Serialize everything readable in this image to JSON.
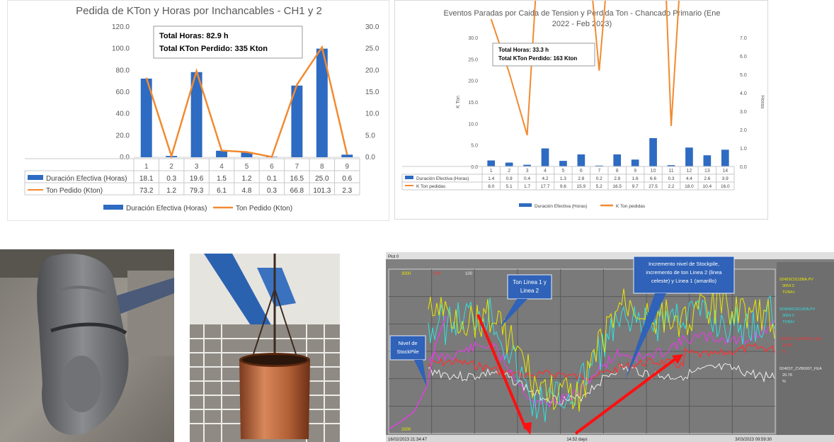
{
  "colors": {
    "bar": "#2e6bc2",
    "line": "#f28a30",
    "axis_text": "#595959"
  },
  "chart_data": [
    {
      "type": "bar",
      "title": "Pedida de KTon y Horas por Inchancables - CH1 y 2",
      "categories": [
        "1",
        "2",
        "3",
        "4",
        "5",
        "6",
        "7",
        "8",
        "9"
      ],
      "series": [
        {
          "name": "Duración Efectiva (Horas)",
          "type": "bar",
          "axis": "right",
          "values": [
            18.1,
            0.3,
            19.6,
            1.5,
            1.2,
            0.1,
            16.5,
            25.0,
            0.6
          ]
        },
        {
          "name": "Ton Pedido (Kton)",
          "type": "line",
          "axis": "left",
          "values": [
            73.2,
            1.2,
            79.3,
            6.1,
            4.8,
            0.3,
            66.8,
            101.3,
            2.3
          ]
        }
      ],
      "left_axis": {
        "ylim": [
          0,
          120
        ],
        "ticks": [
          "0.0",
          "20.0",
          "40.0",
          "60.0",
          "80.0",
          "100.0",
          "120.0"
        ]
      },
      "right_axis": {
        "ylim": [
          0,
          30
        ],
        "ticks": [
          "0.0",
          "5.0",
          "10.0",
          "15.0",
          "20.0",
          "25.0",
          "30.0"
        ]
      },
      "annotation": [
        "Total Horas:  82.9 h",
        "Total KTon Perdido: 335 Kton"
      ],
      "legend_bottom": [
        "Duración Efectiva (Horas)",
        "Ton Pedido (Kton)"
      ],
      "data_table": true
    },
    {
      "type": "bar",
      "title": [
        "Eventos Paradas por Caida de Tension y Perdida Ton - Chancado Primario (Ene",
        "2022 - Feb 2023)"
      ],
      "categories": [
        "1",
        "2",
        "3",
        "4",
        "5",
        "6",
        "7",
        "8",
        "9",
        "10",
        "11",
        "12",
        "13",
        "14"
      ],
      "series": [
        {
          "name": "Duración Efectiva (Horas)",
          "type": "bar",
          "axis": "left",
          "values": [
            1.4,
            0.9,
            0.4,
            4.2,
            1.3,
            2.8,
            0.2,
            2.8,
            1.6,
            6.6,
            0.3,
            4.4,
            2.6,
            3.9
          ]
        },
        {
          "name": "K Ton pedidas",
          "type": "line",
          "axis": "right",
          "values": [
            8.0,
            5.1,
            1.7,
            17.7,
            9.6,
            15.9,
            5.2,
            16.5,
            9.7,
            27.5,
            2.2,
            18.0,
            10.4,
            16.0
          ]
        }
      ],
      "left_axis": {
        "label": "K Ton",
        "ylim": [
          0,
          30
        ],
        "ticks": [
          "0.0",
          "5.0",
          "10.0",
          "15.0",
          "20.0",
          "25.0",
          "30.0"
        ]
      },
      "right_axis": {
        "label": "Horas",
        "ylim": [
          0,
          7
        ],
        "ticks": [
          "0.0",
          "1.0",
          "2.0",
          "3.0",
          "4.0",
          "5.0",
          "6.0",
          "7.0"
        ]
      },
      "annotation": [
        "Total Horas:  33.3 h",
        "Total KTon Perdido: 163 Kton"
      ],
      "legend_bottom": [
        "Duración Efectiva (Horas)",
        "K Ton pedidas"
      ],
      "data_table": true
    }
  ],
  "photos": {
    "left": "worn-crusher-liner-photo",
    "middle": "copper-bushing-hoisted-photo"
  },
  "trend": {
    "plot_label": "Plot 0",
    "top_scale_values": [
      "3000",
      "100",
      "100"
    ],
    "bottom_scale_value": "2000",
    "start_time": "16/02/2023 21:34:47",
    "end_time": "3/03/2023 09:59:30",
    "span": "14.52 days",
    "legend": [
      {
        "tag": "0240SC0115BA.PV",
        "value": "3054.2",
        "unit": "TON/H",
        "color": "#e8e800"
      },
      {
        "tag": "0240WIC01140A.PV",
        "value": "3054.2",
        "unit": "TON/H",
        "color": "#30e0e0"
      },
      {
        "tag": "0240ST_CV00000_FEA",
        "value": "26.83",
        "unit": "%",
        "color": "#ff3030"
      },
      {
        "tag": "0240ST_CVB0007_FEA",
        "value": "20.78",
        "unit": "%",
        "color": "#f0f0f0"
      }
    ],
    "callouts": {
      "ton": [
        "Ton Linea 1 y",
        "Linea 2"
      ],
      "nivel": [
        "Nivel de",
        "StockPile"
      ],
      "incremento": [
        "Incremento nivel de Stockpile,",
        "incremento de ton Linea 2 (linea",
        "celeste) y Linea 1 (amarillo)"
      ]
    }
  }
}
